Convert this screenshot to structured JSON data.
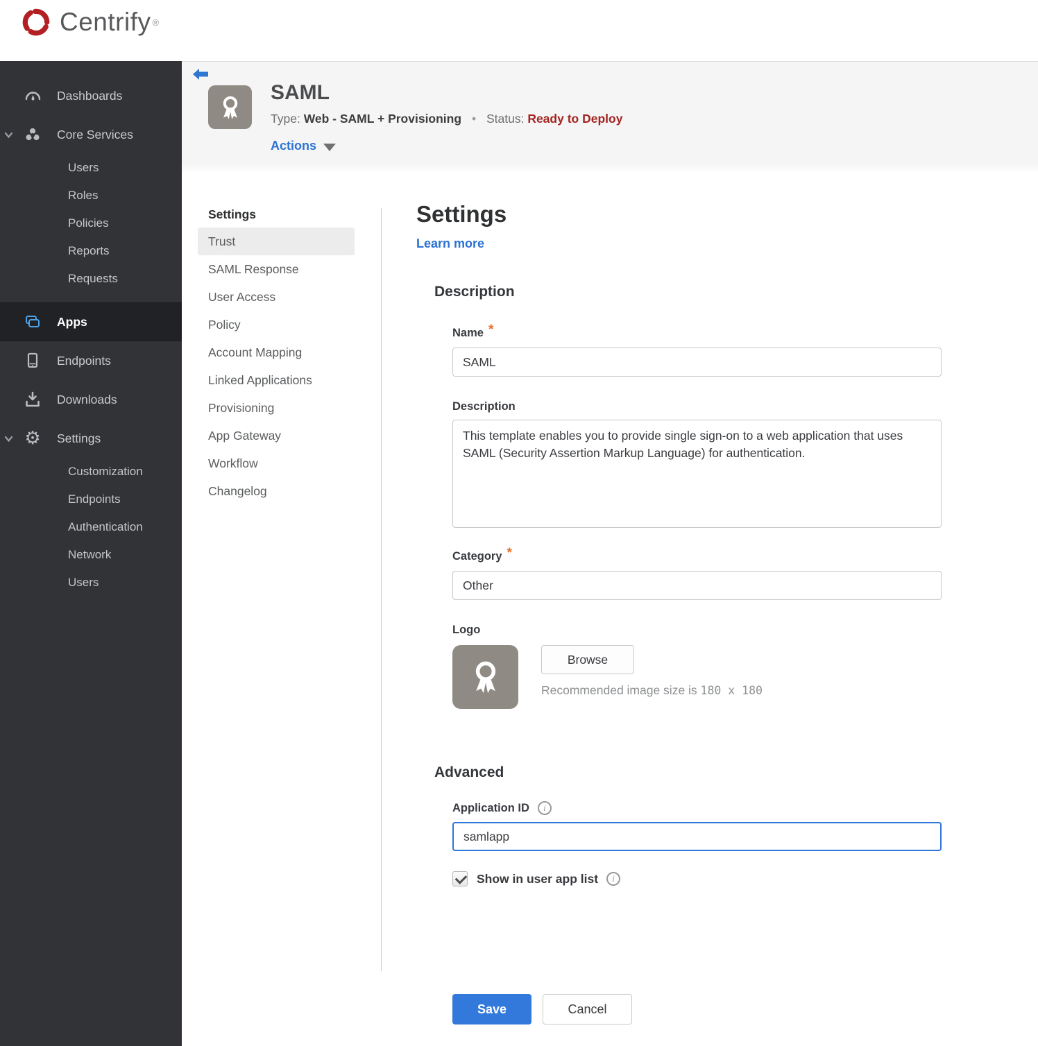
{
  "brand": {
    "name": "Centrify",
    "trademark": "®",
    "logo_color": "#b32024"
  },
  "sidebar": {
    "items": [
      {
        "label": "Dashboards"
      },
      {
        "label": "Core Services",
        "expanded": true,
        "children": [
          "Users",
          "Roles",
          "Policies",
          "Reports",
          "Requests"
        ]
      },
      {
        "label": "Apps",
        "active": true
      },
      {
        "label": "Endpoints"
      },
      {
        "label": "Downloads"
      },
      {
        "label": "Settings",
        "expanded": true,
        "children": [
          "Customization",
          "Endpoints",
          "Authentication",
          "Network",
          "Users"
        ]
      }
    ]
  },
  "app_header": {
    "title": "SAML",
    "type_label": "Type:",
    "type_value": "Web - SAML + Provisioning",
    "separator": "•",
    "status_label": "Status:",
    "status_value": "Ready to Deploy",
    "status_color": "#a32421",
    "actions_label": "Actions"
  },
  "subnav": {
    "header": "Settings",
    "selected": "Trust",
    "items": [
      "Trust",
      "SAML Response",
      "User Access",
      "Policy",
      "Account Mapping",
      "Linked Applications",
      "Provisioning",
      "App Gateway",
      "Workflow",
      "Changelog"
    ]
  },
  "form": {
    "title": "Settings",
    "learn_more": "Learn more",
    "description_section": {
      "heading": "Description",
      "required_marker": "*",
      "name_label": "Name",
      "name_value": "SAML",
      "description_label": "Description",
      "description_value": "This template enables you to provide single sign-on to a web application that uses SAML (Security Assertion Markup Language) for authentication.",
      "category_label": "Category",
      "category_value": "Other",
      "logo_label": "Logo",
      "browse_button": "Browse",
      "recommended_prefix": "Recommended image size is ",
      "recommended_size": "180 x 180"
    },
    "advanced_section": {
      "heading": "Advanced",
      "application_id_label": "Application ID",
      "application_id_value": "samlapp",
      "show_in_user_app_list_label": "Show in user app list",
      "checkbox_checked": true
    },
    "buttons": {
      "save": "Save",
      "cancel": "Cancel"
    },
    "accent_color": "#3379dc"
  },
  "icons": {
    "info_glyph": "i"
  }
}
